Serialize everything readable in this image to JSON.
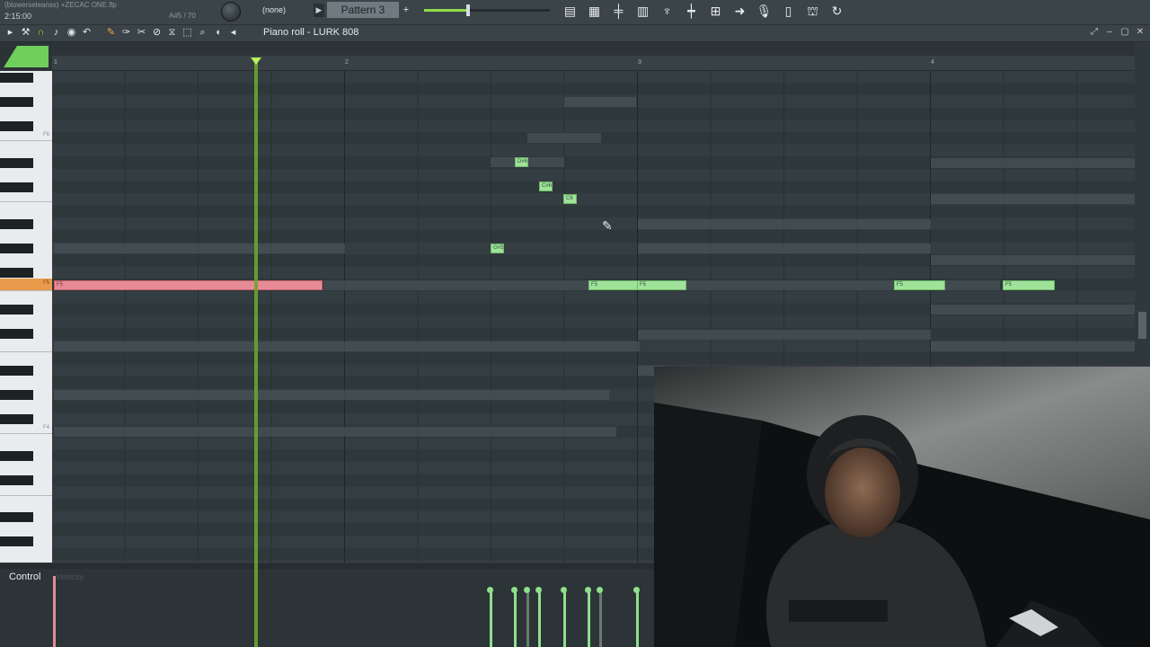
{
  "topbar": {
    "project_name": "(blowerseleanss) +ZECAC ONE.flp",
    "time": "2:15:00",
    "note_readout": "A#5 / 70",
    "channel_select": "(none)",
    "pattern": "Pattern 3",
    "pattern_add": "+",
    "volume_fraction": 0.35,
    "tool_icons": [
      "playlist-icon",
      "piano-roll-icon",
      "mixer-icon",
      "channel-rack-icon",
      "plugin-icon",
      "browser-icon",
      "tempo-icon",
      "arrow-icon",
      "mic-icon",
      "file-icon",
      "stamp-icon",
      "refresh-icon"
    ]
  },
  "piano_roll": {
    "title": "Piano roll - LURK 808",
    "tools": [
      "play-icon",
      "magnet-icon",
      "snap-icon",
      "note-icon",
      "stop-icon",
      "undo-icon",
      "pencil-icon",
      "paint-icon",
      "delete-icon",
      "mute-icon",
      "slice-icon",
      "select-icon",
      "zoom-icon",
      "speaker-icon"
    ],
    "ruler_bars": [
      "1",
      "2",
      "3",
      "4"
    ]
  },
  "keyboard": {
    "labels": [
      "F6",
      "F5",
      "F4"
    ],
    "active_key": "F5"
  },
  "notes": [
    {
      "label": "F5",
      "color": "red"
    },
    {
      "label": "D#6",
      "color": "green"
    },
    {
      "label": "C#6",
      "color": "green"
    },
    {
      "label": "C6",
      "color": "green"
    },
    {
      "label": "G#5",
      "color": "green"
    },
    {
      "label": "F5",
      "color": "green"
    },
    {
      "label": "F5",
      "color": "green"
    },
    {
      "label": "F5",
      "color": "green"
    },
    {
      "label": "F5",
      "color": "green"
    }
  ],
  "control": {
    "label": "Control",
    "sub_label": "Velocity"
  },
  "colors": {
    "accent_green": "#8fdc4a",
    "note_green": "#9fe39a",
    "note_red": "#e58b96",
    "active_key": "#e99a4a"
  }
}
